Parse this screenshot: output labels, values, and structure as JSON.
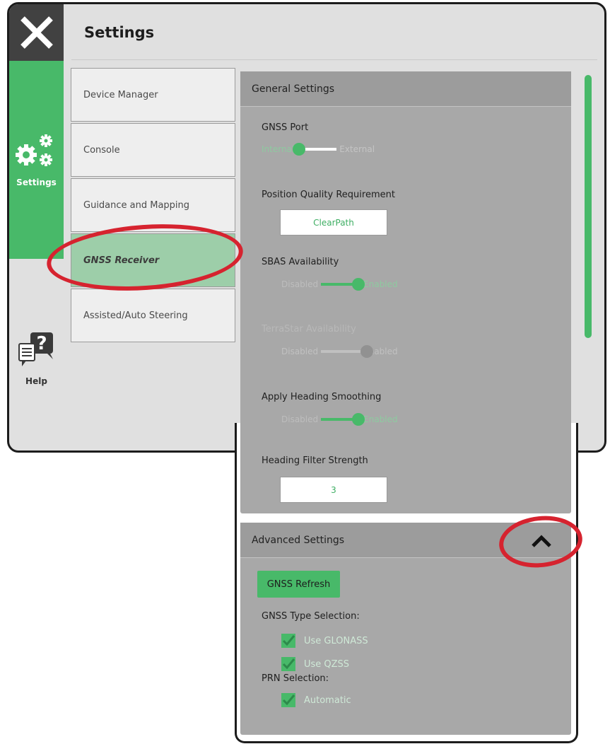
{
  "header": {
    "title": "Settings"
  },
  "nav": {
    "settings_label": "Settings",
    "help_label": "Help"
  },
  "menu": [
    {
      "label": "Device Manager",
      "active": false
    },
    {
      "label": "Console",
      "active": false
    },
    {
      "label": "Guidance and Mapping",
      "active": false
    },
    {
      "label": "GNSS Receiver",
      "active": true
    },
    {
      "label": "Assisted/Auto Steering",
      "active": false
    }
  ],
  "general": {
    "title": "General Settings",
    "gnss_port": {
      "label": "GNSS Port",
      "left": "Internal",
      "right": "External",
      "selected": "Internal"
    },
    "position_quality": {
      "label": "Position Quality Requirement",
      "value": "ClearPath"
    },
    "sbas": {
      "label": "SBAS Availability",
      "left": "Disabled",
      "right": "Enabled",
      "selected": "Enabled"
    },
    "terrastar": {
      "label": "TerraStar Availability",
      "left": "Disabled",
      "right": "Enabled",
      "selected": "Disabled"
    },
    "heading_smoothing": {
      "label": "Apply Heading Smoothing",
      "left": "Disabled",
      "right": "Enabled",
      "selected": "Enabled"
    },
    "heading_filter": {
      "label": "Heading Filter Strength",
      "value": "3"
    }
  },
  "advanced": {
    "title": "Advanced Settings",
    "refresh_label": "GNSS Refresh",
    "type_selection_label": "GNSS Type Selection:",
    "use_glonass": "Use GLONASS",
    "use_qzss": "Use QZSS",
    "prn_label": "PRN Selection:",
    "automatic": "Automatic"
  },
  "icons": {
    "close": "close-icon",
    "settings": "gears-icon",
    "help": "help-chat-icon",
    "collapse": "chevron-up-icon",
    "check": "checkmark-icon"
  },
  "colors": {
    "accent_green": "#48b969",
    "highlight_red": "#d6232f",
    "dark": "#414141"
  }
}
